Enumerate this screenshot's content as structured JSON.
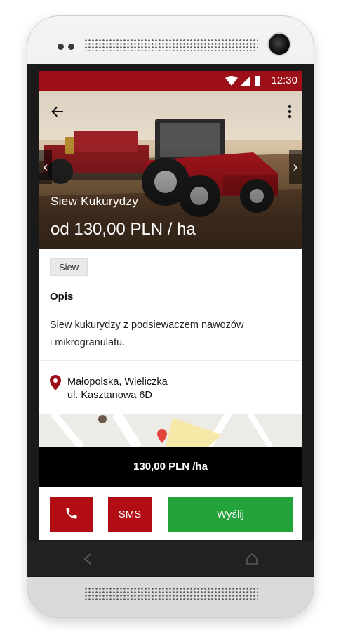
{
  "status": {
    "time": "12:30"
  },
  "hero": {
    "title": "Siew Kukurydzy",
    "price": "od 130,00 PLN / ha",
    "prev_glyph": "‹",
    "next_glyph": "›"
  },
  "tag": "Siew",
  "description": {
    "heading": "Opis",
    "line1": "Siew kukurydzy z podsiewaczem nawozów",
    "line2": "i mikrogranulatu."
  },
  "location": {
    "line1": "Małopolska, Wieliczka",
    "line2": "ul. Kasztanowa 6D"
  },
  "price_bar": "130,00 PLN /ha",
  "actions": {
    "sms_label": "SMS",
    "send_label": "Wyślij"
  },
  "colors": {
    "brand_red": "#9c0f17",
    "button_red": "#b20c14",
    "send_green": "#24a33a"
  },
  "icons": [
    "back-arrow-icon",
    "more-vert-icon",
    "phone-icon",
    "location-pin-icon",
    "wifi-icon",
    "signal-icon",
    "battery-icon"
  ]
}
